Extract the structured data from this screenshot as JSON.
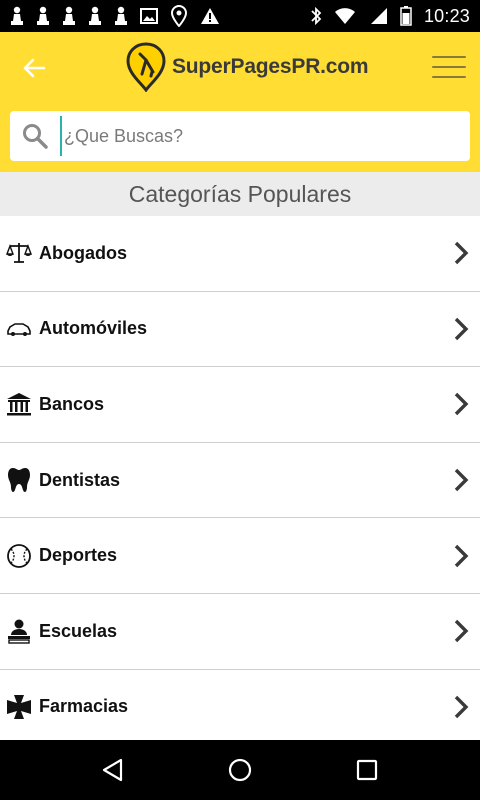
{
  "status_bar": {
    "time": "10:23",
    "left_icons": [
      "chess-pawn-icon",
      "chess-pawn-icon",
      "chess-pawn-icon",
      "chess-pawn-icon",
      "chess-pawn-icon",
      "image-icon",
      "location-pin-icon",
      "warning-icon"
    ],
    "right_icons": [
      "bluetooth-icon",
      "wifi-icon",
      "signal-icon",
      "battery-icon"
    ]
  },
  "header": {
    "logo_text": "SuperPagesPR.com",
    "brand_color": "#ffdd33"
  },
  "search": {
    "placeholder": "¿Que Buscas?",
    "value": ""
  },
  "section": {
    "title": "Categorías Populares"
  },
  "categories": [
    {
      "label": "Abogados",
      "icon": "scales-icon"
    },
    {
      "label": "Automóviles",
      "icon": "car-icon"
    },
    {
      "label": "Bancos",
      "icon": "bank-icon"
    },
    {
      "label": "Dentistas",
      "icon": "tooth-icon"
    },
    {
      "label": "Deportes",
      "icon": "baseball-icon"
    },
    {
      "label": "Escuelas",
      "icon": "school-icon"
    },
    {
      "label": "Farmacias",
      "icon": "pharmacy-cross-icon"
    }
  ],
  "nav": {
    "buttons": [
      "back-triangle-icon",
      "home-circle-icon",
      "recents-square-icon"
    ]
  }
}
